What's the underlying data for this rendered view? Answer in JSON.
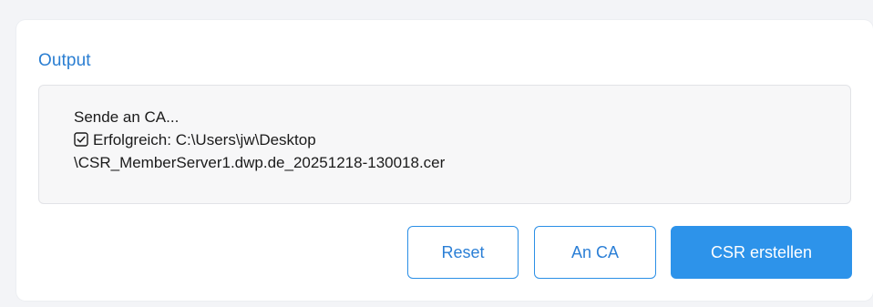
{
  "output": {
    "title": "Output",
    "lines": {
      "line1": "Sende an CA...",
      "line2": "Erfolgreich: C:\\Users\\jw\\Desktop",
      "line3": "\\CSR_MemberServer1.dwp.de_20251218-130018.cer"
    },
    "status_icon": "checkbox-checked-icon"
  },
  "buttons": {
    "reset": "Reset",
    "send_to_ca": "An CA",
    "create_csr": "CSR erstellen"
  },
  "colors": {
    "accent": "#2d93ea",
    "title": "#2a7ed2",
    "background": "#f3f4f7"
  }
}
